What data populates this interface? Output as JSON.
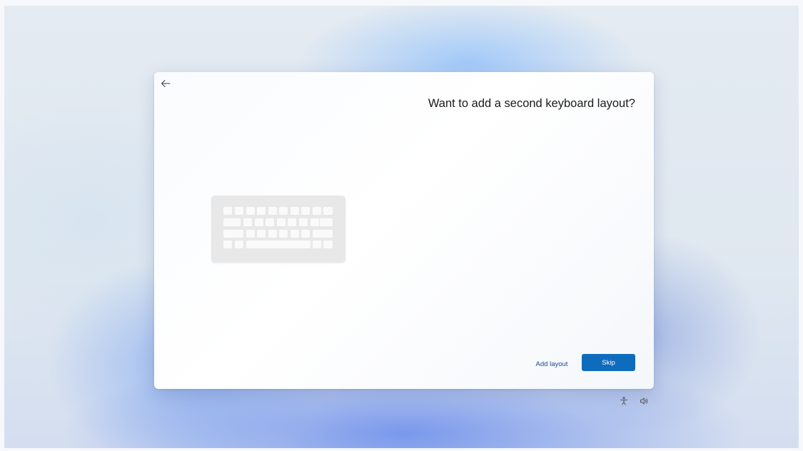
{
  "page": {
    "title": "Want to add a second keyboard layout?"
  },
  "actions": {
    "add_layout_label": "Add layout",
    "skip_label": "Skip"
  },
  "icons": {
    "back": "back-arrow-icon",
    "illustration": "keyboard-illustration",
    "accessibility": "accessibility-icon",
    "volume": "volume-icon"
  },
  "colors": {
    "accent": "#0f6cbd",
    "link": "#1a4a8c",
    "title_text": "#1b1b1b",
    "keyboard_body": "#e8e8e8",
    "keyboard_key": "#fafafa"
  }
}
